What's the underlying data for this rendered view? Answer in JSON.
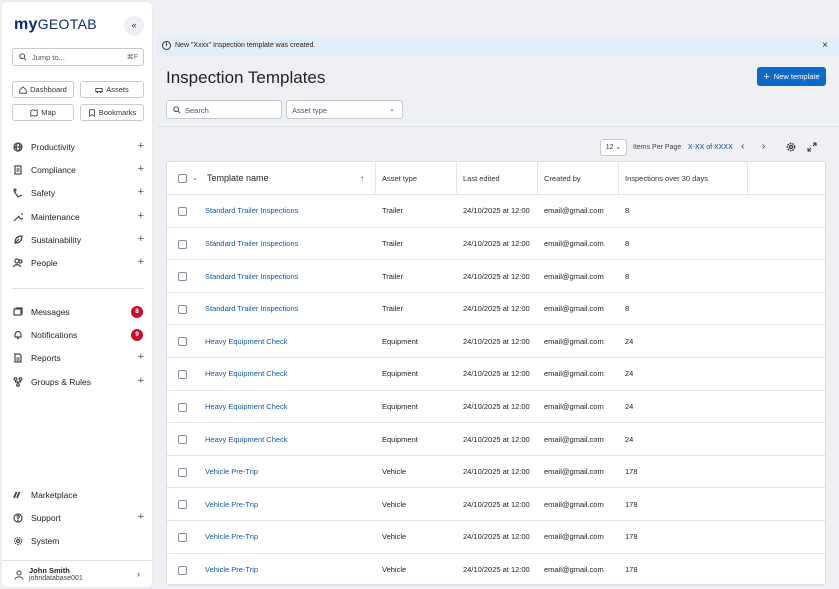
{
  "sidebar": {
    "logo_my": "my",
    "logo_geotab": "GEOTAB",
    "collapse_icon": "«",
    "jump_placeholder": "Jump to...",
    "jump_shortcut": "⌘F",
    "quick": [
      {
        "label": "Dashboard",
        "icon": "home-icon"
      },
      {
        "label": "Assets",
        "icon": "truck-icon"
      },
      {
        "label": "Map",
        "icon": "map-icon"
      },
      {
        "label": "Bookmarks",
        "icon": "bookmark-icon"
      }
    ],
    "nav": [
      {
        "label": "Productivity",
        "icon": "globe-icon",
        "plus": "+"
      },
      {
        "label": "Compliance",
        "icon": "clipboard-icon",
        "plus": "+"
      },
      {
        "label": "Safety",
        "icon": "safety-icon",
        "plus": "+"
      },
      {
        "label": "Maintenance",
        "icon": "wrench-icon",
        "plus": "+"
      },
      {
        "label": "Sustainability",
        "icon": "leaf-icon",
        "plus": "+"
      },
      {
        "label": "People",
        "icon": "people-icon",
        "plus": "+"
      }
    ],
    "nav2": [
      {
        "label": "Messages",
        "icon": "messages-icon",
        "badge": "8"
      },
      {
        "label": "Notifications",
        "icon": "bell-icon",
        "badge": "9"
      },
      {
        "label": "Reports",
        "icon": "report-icon",
        "plus": "+"
      },
      {
        "label": "Groups & Rules",
        "icon": "groups-icon",
        "plus": "+"
      }
    ],
    "bottom": [
      {
        "label": "Marketplace",
        "icon": "marketplace-icon"
      },
      {
        "label": "Support",
        "icon": "help-icon",
        "plus": "+"
      },
      {
        "label": "System",
        "icon": "gear-icon"
      }
    ],
    "user": {
      "name": "John Smith",
      "database": "johndatabase001"
    }
  },
  "banner": {
    "message": "New \"Xxxx\" Inspection template was created.",
    "close": "×"
  },
  "header": {
    "title": "Inspection Templates",
    "new_button": "New template"
  },
  "filters": {
    "search_placeholder": "Search",
    "asset_type_placeholder": "Asset type"
  },
  "pagination": {
    "per_page": "12",
    "per_page_label": "Items Per Page",
    "range": "X-XX of XXXX"
  },
  "table": {
    "columns": [
      "Template name",
      "Asset type",
      "Last edited",
      "Created by",
      "Inspections over 30 days"
    ],
    "rows": [
      [
        "Standard Trailer Inspections",
        "Trailer",
        "24/10/2025 at 12:00",
        "email@gmail.com",
        "8"
      ],
      [
        "Standard Trailer Inspections",
        "Trailer",
        "24/10/2025 at 12:00",
        "email@gmail.com",
        "8"
      ],
      [
        "Standard Trailer Inspections",
        "Trailer",
        "24/10/2025 at 12:00",
        "email@gmail.com",
        "8"
      ],
      [
        "Standard Trailer Inspections",
        "Trailer",
        "24/10/2025 at 12:00",
        "email@gmail.com",
        "8"
      ],
      [
        "Heavy Equipment Check",
        "Equipment",
        "24/10/2025 at 12:00",
        "email@gmail.com",
        "24"
      ],
      [
        "Heavy Equipment Check",
        "Equipment",
        "24/10/2025 at 12:00",
        "email@gmail.com",
        "24"
      ],
      [
        "Heavy Equipment Check",
        "Equipment",
        "24/10/2025 at 12:00",
        "email@gmail.com",
        "24"
      ],
      [
        "Heavy Equipment Check",
        "Equipment",
        "24/10/2025 at 12:00",
        "email@gmail.com",
        "24"
      ],
      [
        "Vehicle Pre-Trip",
        "Vehicle",
        "24/10/2025 at 12:00",
        "email@gmail.com",
        "178"
      ],
      [
        "Vehicle Pre-Trip",
        "Vehicle",
        "24/10/2025 at 12:00",
        "email@gmail.com",
        "178"
      ],
      [
        "Vehicle Pre-Trip",
        "Vehicle",
        "24/10/2025 at 12:00",
        "email@gmail.com",
        "178"
      ],
      [
        "Vehicle Pre-Trip",
        "Vehicle",
        "24/10/2025 at 12:00",
        "email@gmail.com",
        "178"
      ]
    ]
  },
  "colors": {
    "accent": "#0d6ac9",
    "link": "#0d5aa7",
    "badge": "#c8102e",
    "banner_bg": "#e4eef9"
  }
}
